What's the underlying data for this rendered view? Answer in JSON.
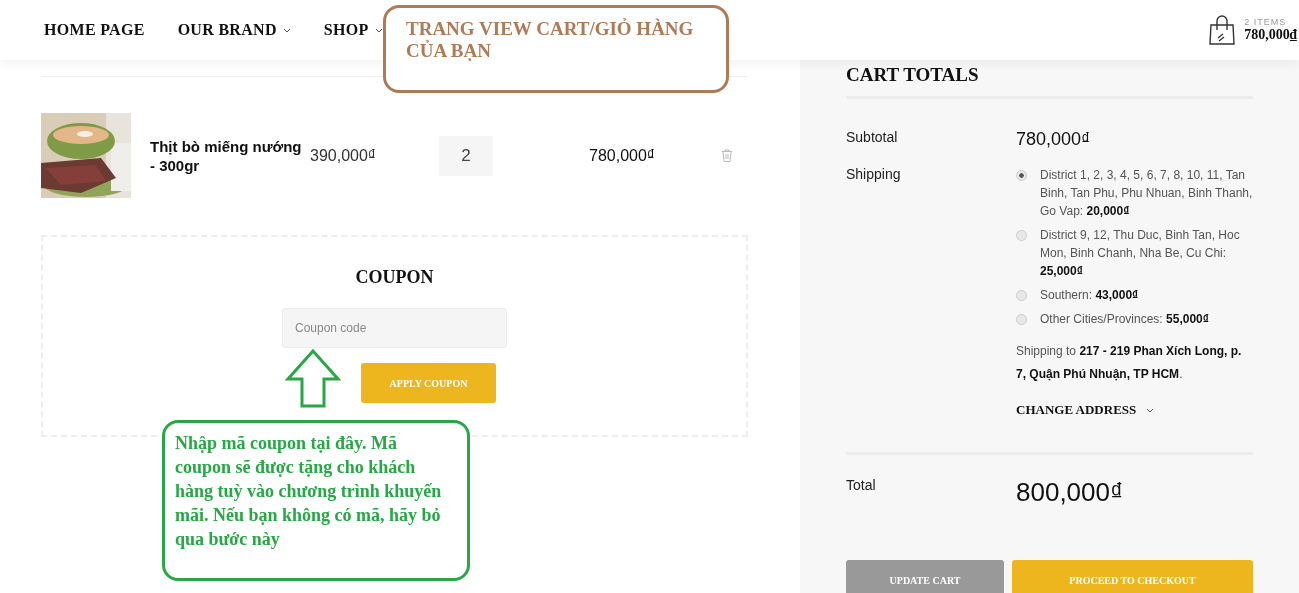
{
  "nav": [
    {
      "label": "HOME PAGE",
      "dropdown": false
    },
    {
      "label": "OUR BRAND",
      "dropdown": true
    },
    {
      "label": "SHOP",
      "dropdown": true
    }
  ],
  "mini_cart": {
    "count": "2 ITEMS",
    "total": "780,000₫"
  },
  "cart_items": [
    {
      "kind": "picture",
      "name": "Thịt bò miếng nướng - 300gr",
      "price": "390,000₫",
      "quantity": "2",
      "subtotal": "780,000₫"
    }
  ],
  "coupon": {
    "title": "COUPON",
    "placeholder": "Coupon code",
    "button": "APPLY COUPON"
  },
  "cart_totals": {
    "title": "CART TOTALS",
    "subtotal_label": "Subtotal",
    "subtotal": "780,000₫",
    "shipping_label": "Shipping",
    "shipping_options": [
      {
        "text": "District 1, 2, 3, 4, 5, 6, 7, 8, 10, 11, Tan Binh, Tan Phu, Phu Nhuan, Binh Thanh, Go Vap: **20,000₫**",
        "selected": true
      },
      {
        "text": "District 9, 12, Thu Duc, Binh Tan, Hoc Mon, Binh Chanh, Nha Be, Cu Chi: **25,000₫**",
        "selected": false
      },
      {
        "text": "Southern: **43,000₫**",
        "selected": false
      },
      {
        "text": "Other Cities/Provinces: **55,000₫**",
        "selected": false
      }
    ],
    "shipping_to": "Shipping to **217 - 219 Phan Xích Long, p. 7, Quận Phú Nhuận, TP HCM**.",
    "change_address": "CHANGE ADDRESS",
    "total_label": "Total",
    "total": "800,000₫",
    "buttons": [
      {
        "kind": "secondary",
        "label": "UPDATE CART"
      },
      {
        "kind": "primary",
        "label": "PROCEED TO CHECKOUT"
      }
    ]
  },
  "annotations": [
    {
      "kind": "title",
      "text": "TRANG VIEW CART/GIỎ HÀNG CỦA BẠN"
    },
    {
      "kind": "note",
      "text": "Nhập mã coupon tại đây. Mã coupon sẽ được tặng cho khách hàng tuỳ vào chương trình khuyến mãi. Nếu bạn không có mã, hãy bỏ qua bước này"
    }
  ]
}
